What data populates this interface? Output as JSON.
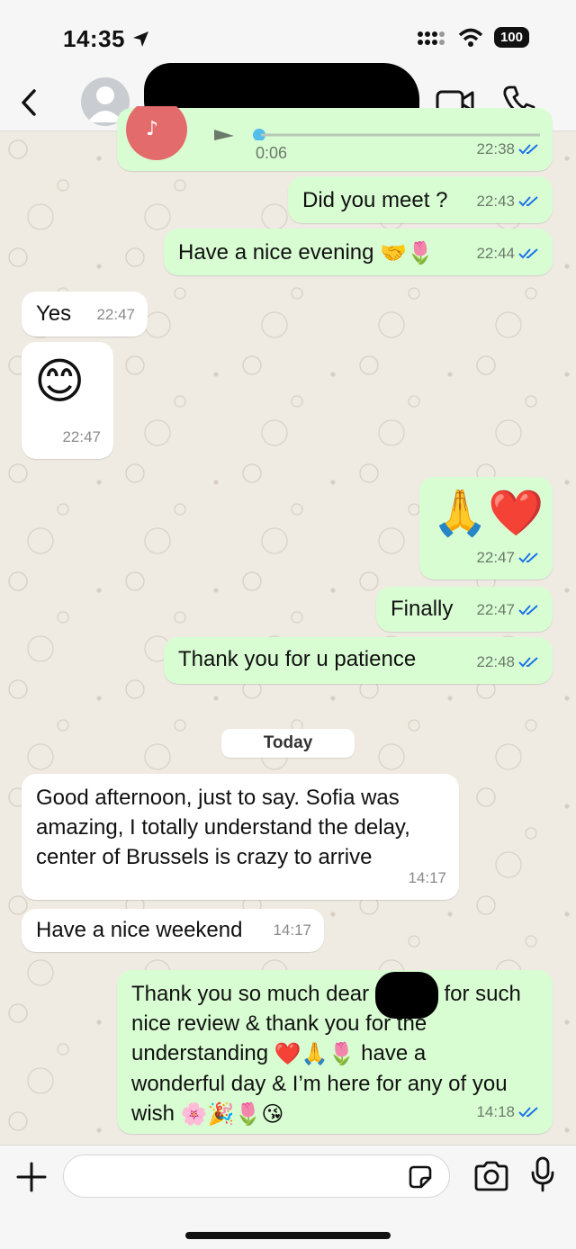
{
  "status_bar": {
    "time": "14:35",
    "battery": "100"
  },
  "header": {
    "contact_name": ""
  },
  "messages": [
    {
      "direction": "out",
      "duration": "0:06",
      "time": "22:38"
    },
    {
      "direction": "out",
      "text": "Did you meet ?",
      "time": "22:43"
    },
    {
      "direction": "out",
      "text": "Have a nice evening",
      "emoji": "🤝🌷",
      "time": "22:44"
    },
    {
      "direction": "in",
      "text": "Yes",
      "time": "22:47"
    },
    {
      "direction": "in",
      "emoji": "😊",
      "time": "22:47"
    },
    {
      "direction": "out",
      "emoji": "🙏❤️",
      "time": "22:47"
    },
    {
      "direction": "out",
      "text": "Finally",
      "time": "22:47"
    },
    {
      "direction": "out",
      "text": "Thank you for u patience",
      "time": "22:48"
    },
    {
      "direction": "in",
      "lines": [
        "Good afternoon, just to say. Sofia was",
        "amazing, I totally understand the delay,",
        "center of Brussels is crazy to arrive"
      ],
      "time": "14:17"
    },
    {
      "direction": "in",
      "text": "Have a nice weekend",
      "time": "14:17"
    },
    {
      "direction": "out",
      "lines": [
        "Thank you so much dear",
        "for such",
        "nice review & thank you for the",
        "understanding",
        "have a",
        "wonderful day & I’m here for any of you",
        "wish"
      ],
      "emoji_a": "❤️🙏🌷",
      "emoji_b": "🌸🎉🌷😘",
      "time": "14:18"
    }
  ],
  "date_separator": "Today",
  "colors": {
    "outgoing": "#d9fdd3",
    "incoming": "#ffffff",
    "tick_blue": "#1a73e8",
    "wallpaper": "#efeae2"
  },
  "icons": [
    "back-icon",
    "avatar-icon",
    "video-icon",
    "phone-icon",
    "plus-icon",
    "sticker-icon",
    "camera-icon",
    "mic-icon",
    "location-arrow-icon",
    "signal-icon",
    "wifi-icon"
  ],
  "input": {
    "placeholder": "",
    "value": ""
  }
}
